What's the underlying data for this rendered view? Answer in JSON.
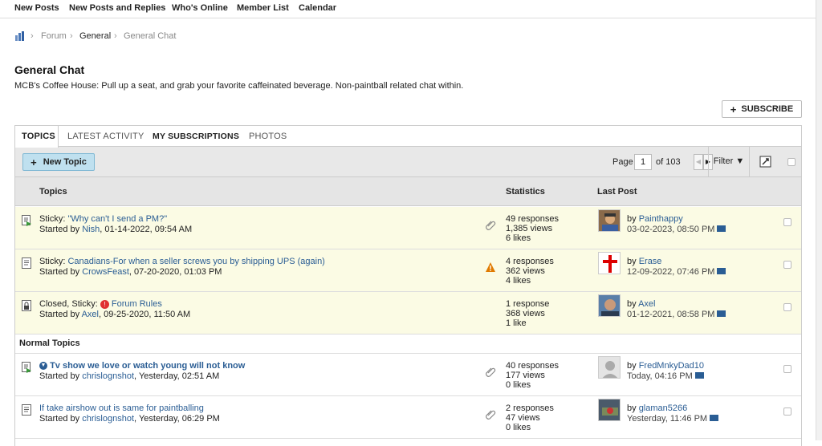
{
  "topnav": [
    "New Posts",
    "New Posts and Replies",
    "Who's Online",
    "Member List",
    "Calendar"
  ],
  "breadcrumb": {
    "items": [
      "Forum",
      "General",
      "General Chat"
    ]
  },
  "page": {
    "title": "General Chat",
    "description": "MCB's Coffee House: Pull up a seat, and grab your favorite caffeinated beverage. Non-paintball related chat within.",
    "subscribe": "SUBSCRIBE"
  },
  "tabs": [
    "TOPICS",
    "LATEST ACTIVITY",
    "MY SUBSCRIPTIONS",
    "PHOTOS"
  ],
  "toolbar": {
    "new_topic": "New Topic",
    "page_label": "Page",
    "page_value": "1",
    "of_label": "of 103",
    "filter": "Filter"
  },
  "columns": {
    "topics": "Topics",
    "statistics": "Statistics",
    "last_post": "Last Post"
  },
  "sticky_topics": [
    {
      "prefix": "Sticky:",
      "title": "\"Why can't I send a PM?\"",
      "started": "Started by",
      "author": "Nish",
      "date": ", 01-14-2022, 09:54 AM",
      "responses": "49 responses",
      "views": "1,385 views",
      "likes": "6 likes",
      "last_by": "by",
      "last_user": "Painthappy",
      "last_date": "03-02-2023, 08:50 PM",
      "attach": "paperclip-icon",
      "icon": "new-posts-icon"
    },
    {
      "prefix": "Sticky:",
      "title": "Canadians-For when a seller screws you by shipping UPS (again)",
      "started": "Started by",
      "author": "CrowsFeast",
      "date": ", 07-20-2020, 01:03 PM",
      "responses": "4 responses",
      "views": "362 views",
      "likes": "4 likes",
      "last_by": "by",
      "last_user": "Erase",
      "last_date": "12-09-2022, 07:46 PM",
      "attach": "warning-icon",
      "icon": "topic-icon"
    },
    {
      "prefix": "Closed, Sticky:",
      "title": "Forum Rules",
      "started": "Started by",
      "author": "Axel",
      "date": ", 09-25-2020, 11:50 AM",
      "responses": "1 response",
      "views": "368 views",
      "likes": "1 like",
      "last_by": "by",
      "last_user": "Axel",
      "last_date": "01-12-2021, 08:58 PM",
      "attach": "",
      "icon": "lock-icon"
    }
  ],
  "normal_header": "Normal Topics",
  "normal_topics": [
    {
      "prefix": "",
      "title": "Tv show we love or watch young will not know",
      "started": "Started by",
      "author": "chrislognshot",
      "date": ", Yesterday, 02:51 AM",
      "responses": "40 responses",
      "views": "177 views",
      "likes": "0 likes",
      "last_by": "by",
      "last_user": "FredMnkyDad10",
      "last_date": "Today, 04:16 PM",
      "attach": "paperclip-icon",
      "icon": "new-posts-icon"
    },
    {
      "prefix": "",
      "title": "If take airshow out is same for paintballing",
      "started": "Started by",
      "author": "chrislognshot",
      "date": ", Yesterday, 06:29 PM",
      "responses": "2 responses",
      "views": "47 views",
      "likes": "0 likes",
      "last_by": "by",
      "last_user": "glaman5266",
      "last_date": "Yesterday, 11:46 PM",
      "attach": "paperclip-icon",
      "icon": "topic-icon"
    }
  ],
  "colors": {
    "link": "#2a5d94",
    "sticky_bg": "#fbfbe4",
    "button_blue": "#bfe0ef"
  }
}
